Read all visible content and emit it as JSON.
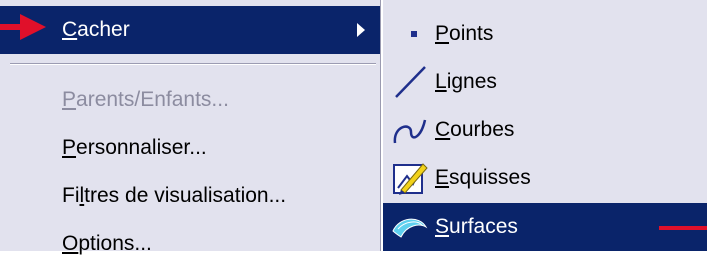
{
  "main_menu": {
    "items": [
      {
        "accel": "C",
        "rest": "acher"
      },
      {
        "accel": "P",
        "rest": "arents/Enfants..."
      },
      {
        "accel": "P",
        "rest": "ersonnaliser..."
      },
      {
        "pre": "Fi",
        "accel": "l",
        "rest": "tres de visualisation..."
      },
      {
        "accel": "O",
        "rest": "ptions..."
      }
    ]
  },
  "submenu": {
    "items": [
      {
        "icon": "point-icon",
        "accel": "P",
        "rest": "oints"
      },
      {
        "icon": "line-icon",
        "accel": "L",
        "rest": "ignes"
      },
      {
        "icon": "curve-icon",
        "accel": "C",
        "rest": "ourbes"
      },
      {
        "icon": "sketch-icon",
        "accel": "E",
        "rest": "squisses"
      },
      {
        "icon": "surface-icon",
        "accel": "S",
        "rest": "urfaces"
      }
    ]
  },
  "colors": {
    "menu_bg": "#e2e2ee",
    "selection_bg": "#0a246a",
    "pointer_red": "#e0102a",
    "disabled_text": "#8c8ca0"
  }
}
